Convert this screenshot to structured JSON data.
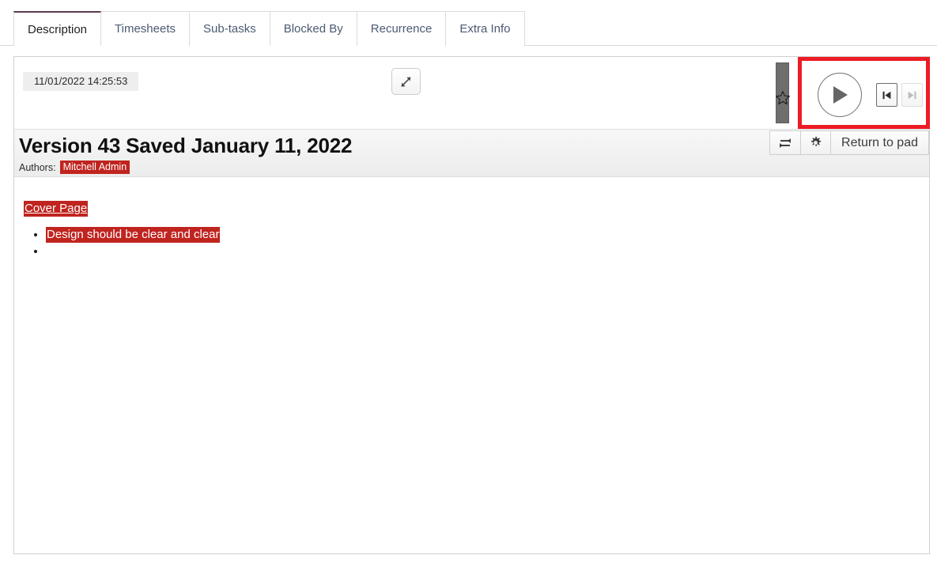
{
  "tabs": [
    {
      "label": "Description",
      "active": true
    },
    {
      "label": "Timesheets",
      "active": false
    },
    {
      "label": "Sub-tasks",
      "active": false
    },
    {
      "label": "Blocked By",
      "active": false
    },
    {
      "label": "Recurrence",
      "active": false
    },
    {
      "label": "Extra Info",
      "active": false
    }
  ],
  "timeslider": {
    "timestamp": "11/01/2022 14:25:53",
    "expand_icon": "expand-arrows-icon",
    "star_icon": "star-outline-icon",
    "handle_name": "timeslider-handle",
    "play_icon": "play-icon",
    "prev_icon": "step-backward-icon",
    "next_icon": "step-forward-icon",
    "next_disabled": true,
    "annotation_color": "#ed1c24"
  },
  "version_header": {
    "title": "Version 43 Saved January 11, 2022",
    "authors_label": "Authors:",
    "author_name": "Mitchell Admin",
    "author_highlight_color": "#c0241f",
    "controls": {
      "swap_icon": "swap-arrows-icon",
      "settings_icon": "gear-icon",
      "return_label": "Return to pad"
    }
  },
  "document": {
    "heading": "Cover Page",
    "items": [
      "Design should be clear and clear",
      ""
    ],
    "highlight_color": "#c0241f"
  }
}
